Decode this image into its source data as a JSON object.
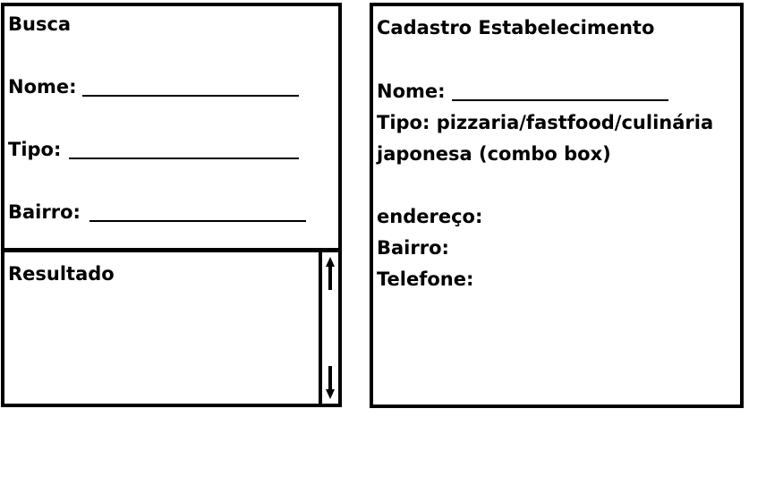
{
  "busca": {
    "title": "Busca",
    "nome_label": "Nome:",
    "tipo_label": "Tipo:",
    "bairro_label": "Bairro:"
  },
  "resultado": {
    "title": "Resultado"
  },
  "cadastro": {
    "title": "Cadastro Estabelecimento",
    "nome_label": "Nome:",
    "tipo_line1": "Tipo: pizzaria/fastfood/culinária",
    "tipo_line2": "japonesa (combo box)",
    "endereco_label": "endereço:",
    "bairro_label": "Bairro:",
    "telefone_label": "Telefone:"
  },
  "icons": {
    "scroll_up": "arrow-up-icon",
    "scroll_down": "arrow-down-icon"
  }
}
